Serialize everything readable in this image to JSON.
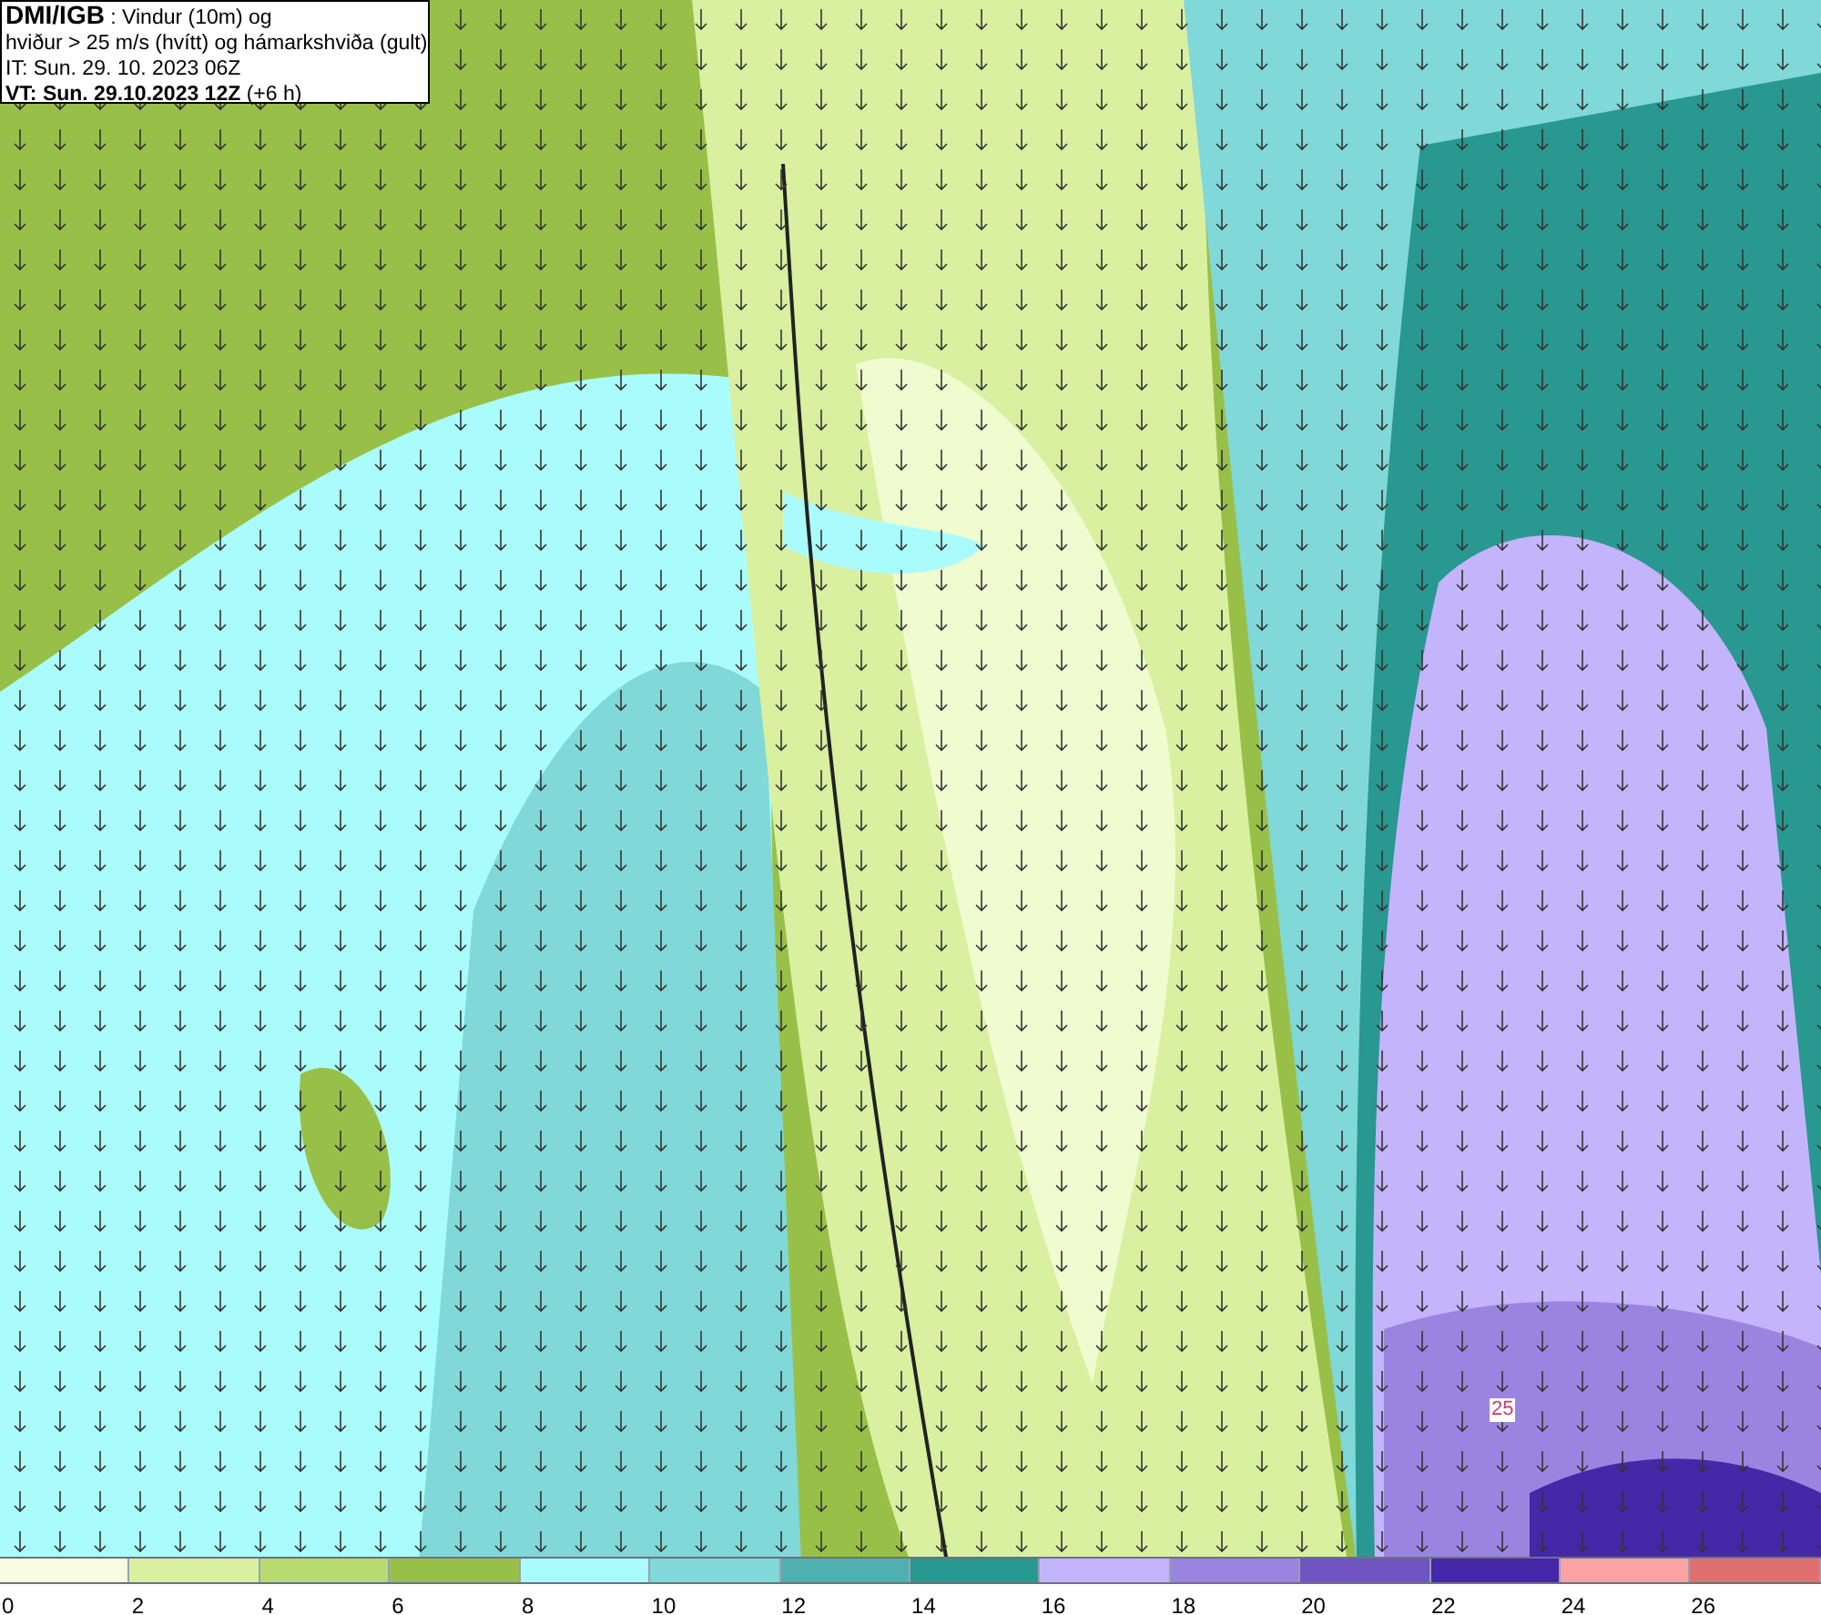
{
  "title_box": {
    "source": "DMI/IGB",
    "lines": [
      " : Vindur (10m) og",
      "hviður > 25 m/s (hvítt) og hámarkshviða (gult)",
      "IT: Sun. 29. 10. 2023 06Z"
    ],
    "valid_time": "VT: Sun. 29.10.2023 12Z",
    "lead": " (+6 h)"
  },
  "map": {
    "contour_label": "25"
  },
  "legend": {
    "bins": [
      {
        "label": "0",
        "color": "#f7fde0"
      },
      {
        "label": "2",
        "color": "#d8f0a0"
      },
      {
        "label": "4",
        "color": "#b8da70"
      },
      {
        "label": "6",
        "color": "#98c048"
      },
      {
        "label": "8",
        "color": "#aafcfc"
      },
      {
        "label": "10",
        "color": "#80d8d8"
      },
      {
        "label": "12",
        "color": "#50b0b0"
      },
      {
        "label": "14",
        "color": "#289890"
      },
      {
        "label": "16",
        "color": "#c4b4fc"
      },
      {
        "label": "18",
        "color": "#9a84e0"
      },
      {
        "label": "20",
        "color": "#7054c0"
      },
      {
        "label": "22",
        "color": "#4428a8"
      },
      {
        "label": "24",
        "color": "#fca4a4"
      },
      {
        "label": "26",
        "color": "#e07070"
      }
    ]
  }
}
